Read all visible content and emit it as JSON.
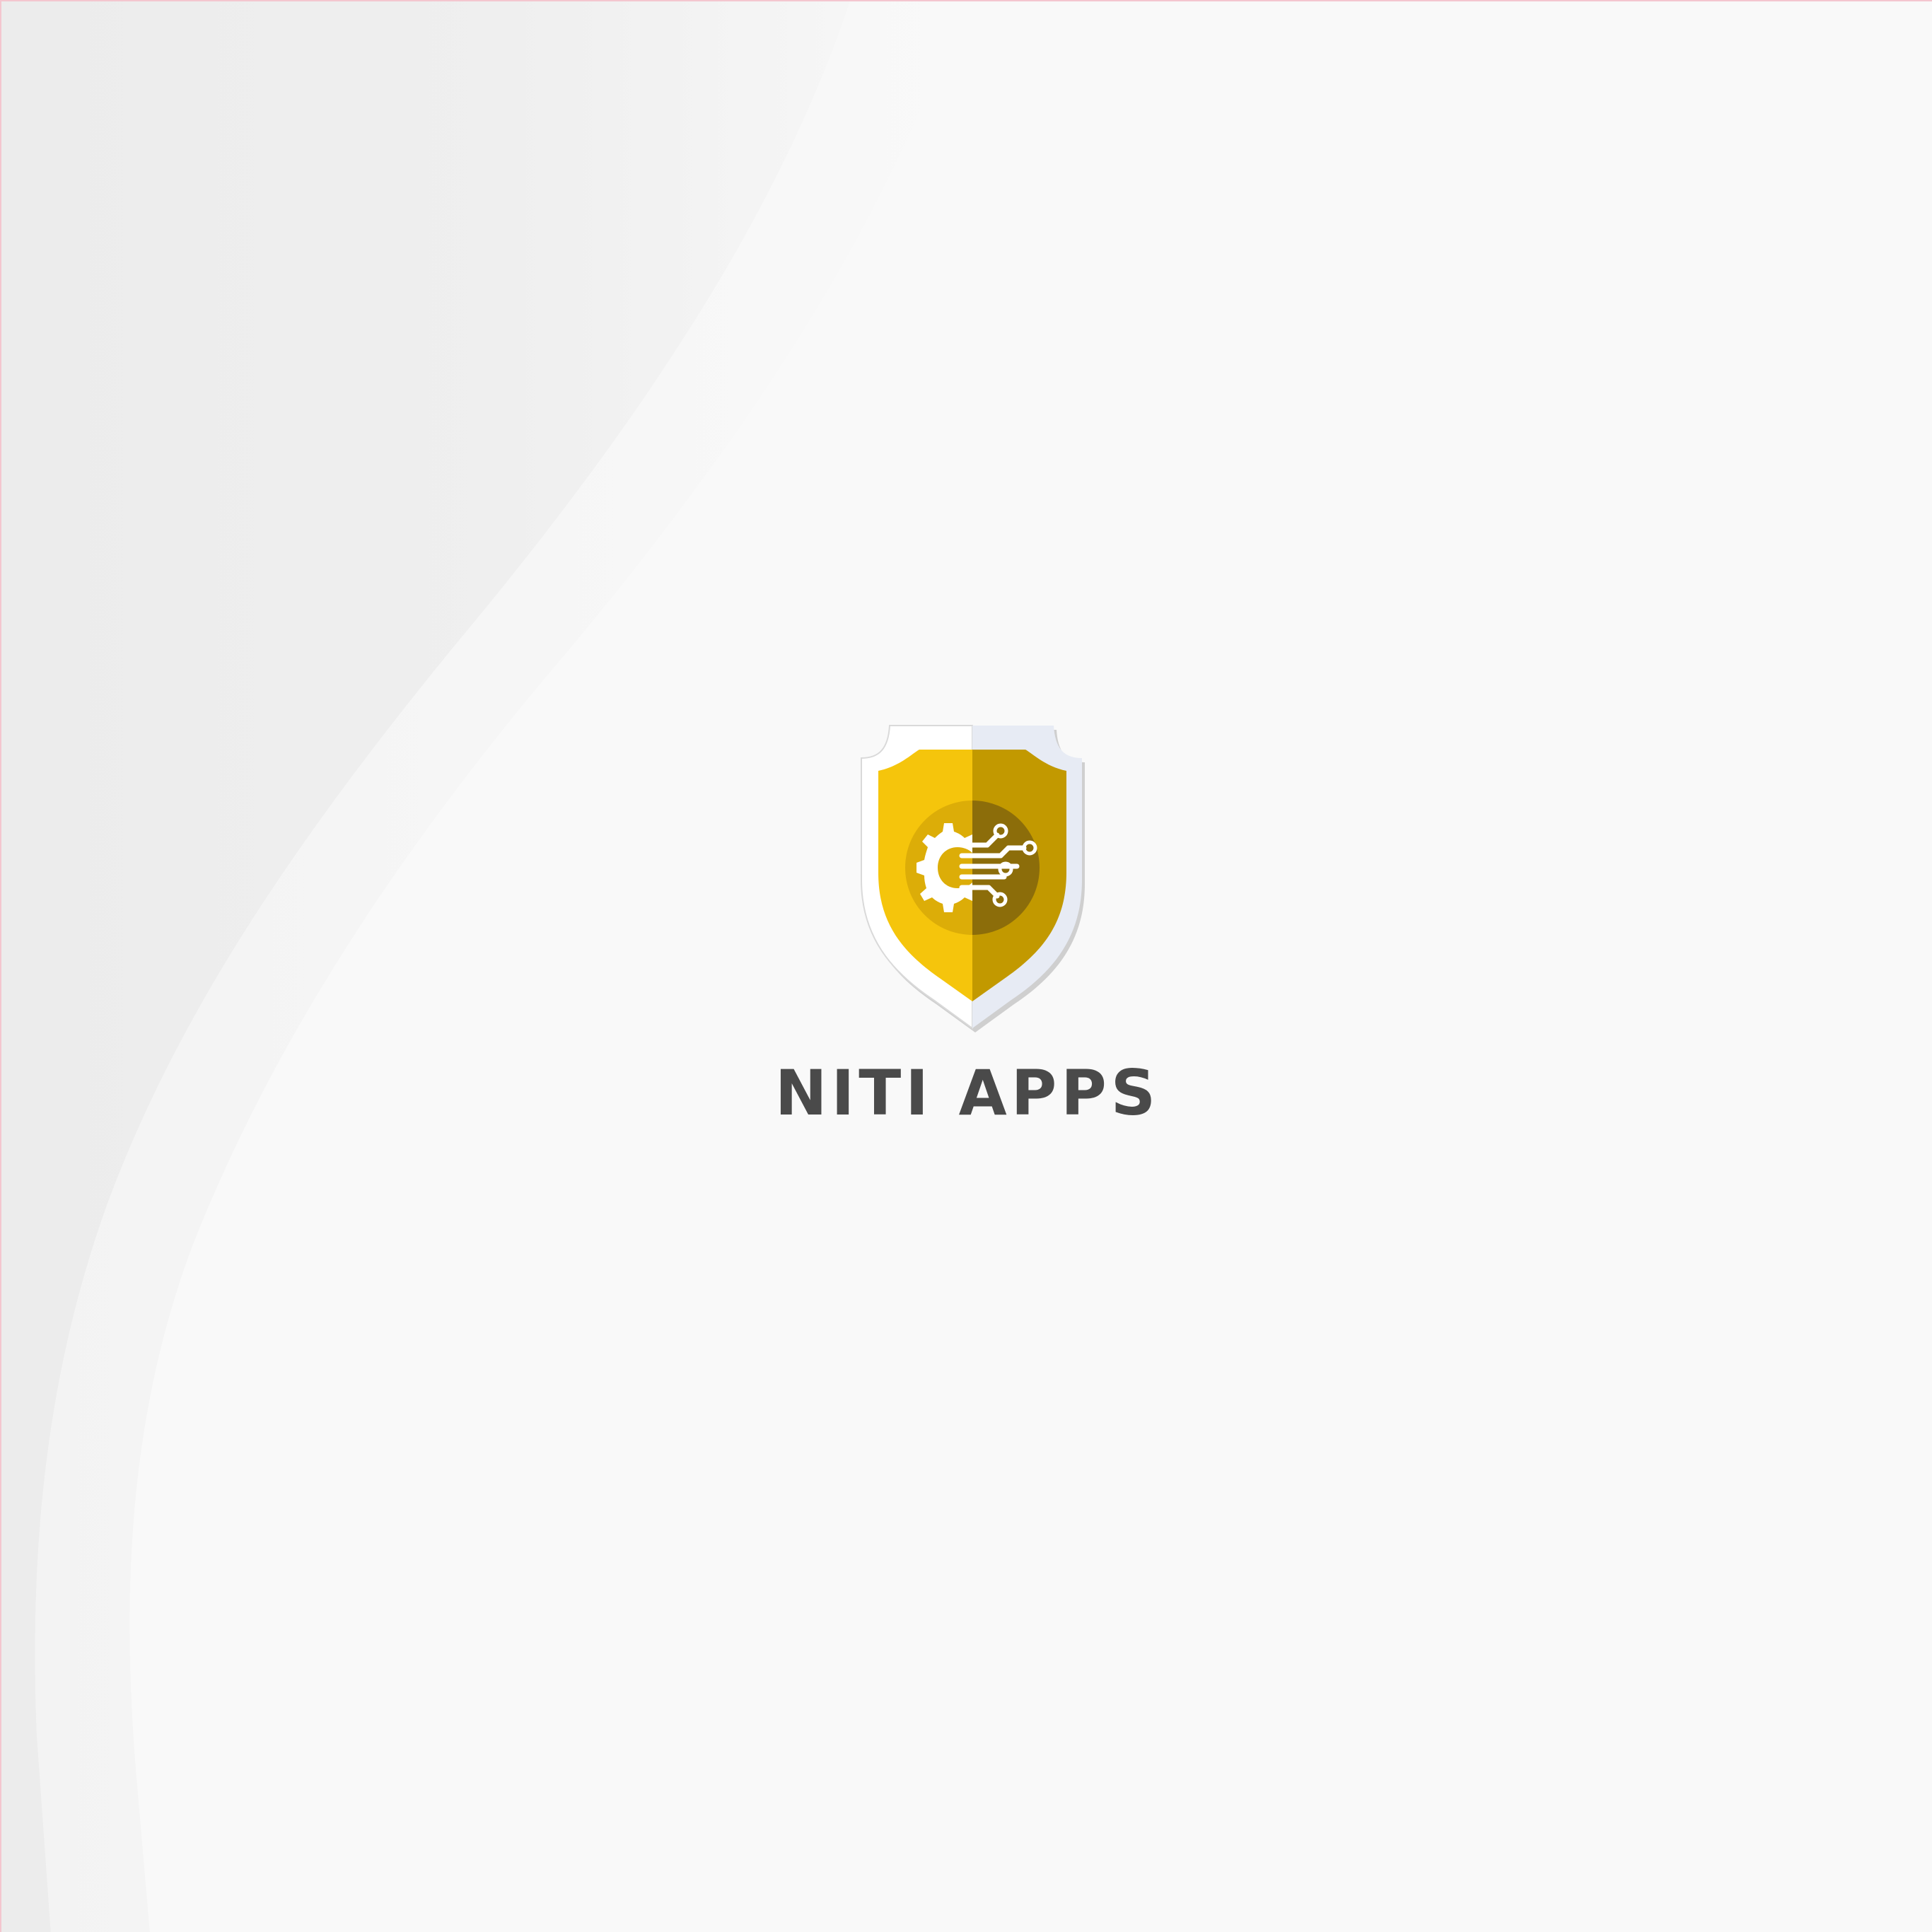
{
  "splash": {
    "brand_name": "NITI APPS"
  },
  "logo": {
    "icon": "shield-gear-circuit-icon",
    "colors": {
      "shield_left": "#f5c50c",
      "shield_right": "#c29900",
      "rim_light": "#ffffff",
      "rim_shade": "#e7ebf4",
      "circle_left": "#dcad08",
      "circle_right": "#8c6d0a"
    }
  },
  "theme": {
    "background": "#f9f9f9",
    "wave_shade": "#ececec",
    "text_color": "#4a4a4a"
  }
}
